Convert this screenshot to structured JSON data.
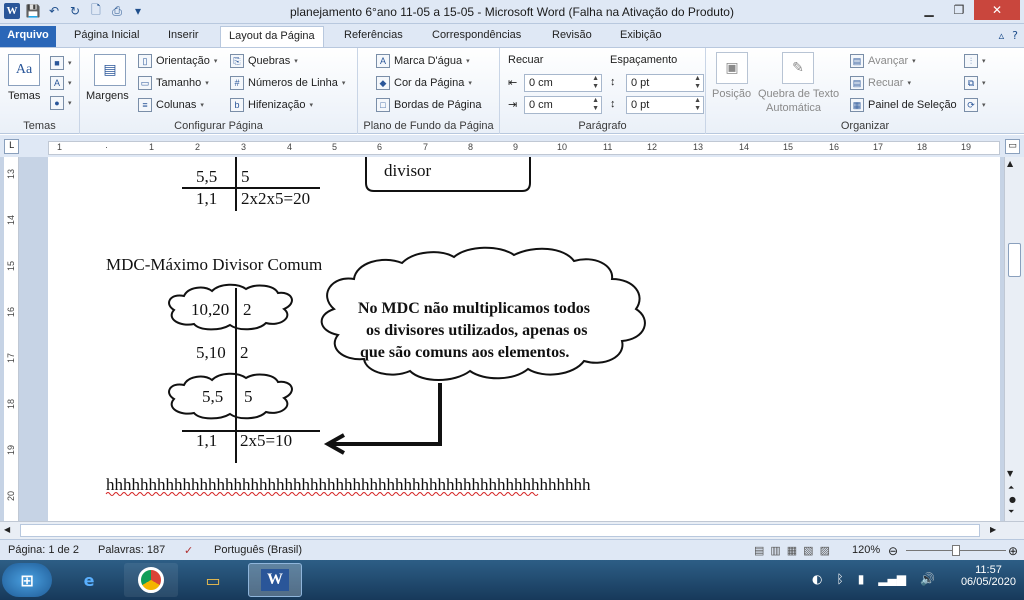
{
  "window": {
    "title": "planejamento 6°ano 11-05 a 15-05  -  Microsoft Word (Falha na Ativação do Produto)"
  },
  "qat": {
    "logo": "W",
    "save": "💾",
    "undo": "↶",
    "redo": "↻",
    "preview": "🗋",
    "print": "⎙",
    "more": "▾"
  },
  "tabs": [
    {
      "label": "Arquivo"
    },
    {
      "label": "Página Inicial"
    },
    {
      "label": "Inserir"
    },
    {
      "label": "Layout da Página"
    },
    {
      "label": "Referências"
    },
    {
      "label": "Correspondências"
    },
    {
      "label": "Revisão"
    },
    {
      "label": "Exibição"
    }
  ],
  "ribbon": {
    "temas": {
      "label": "Temas",
      "group": "Temas"
    },
    "configurar": {
      "margens": "Margens",
      "orientacao": "Orientação",
      "tamanho": "Tamanho",
      "colunas": "Colunas",
      "quebras": "Quebras",
      "numeros_linha": "Números de Linha",
      "hifenizacao": "Hifenização",
      "group": "Configurar Página"
    },
    "fundo": {
      "marca_dagua": "Marca D'água",
      "cor_pagina": "Cor da Página",
      "bordas": "Bordas de Página",
      "group": "Plano de Fundo da Página"
    },
    "paragrafo": {
      "recuar": "Recuar",
      "espacamento": "Espaçamento",
      "recuo_esq": "0 cm",
      "recuo_dir": "0 cm",
      "esp_antes": "0 pt",
      "esp_depois": "0 pt",
      "group": "Parágrafo"
    },
    "organizar": {
      "posicao": "Posição",
      "quebra_texto_1": "Quebra de Texto",
      "quebra_texto_2": "Automática",
      "avancar": "Avançar",
      "recuar": "Recuar",
      "painel": "Painel de Seleção",
      "group": "Organizar"
    }
  },
  "document": {
    "top_cloud_text": "divisor",
    "top_row1_left": "5,5",
    "top_row1_right": "5",
    "top_row2_left": "1,1",
    "top_row2_right": "2x2x5=20",
    "heading": "MDC-Máximo Divisor Comum",
    "row1_left": "10,20",
    "row1_right": "2",
    "row2_left": "5,10",
    "row2_right": "2",
    "row3_left": "5,5",
    "row3_right": "5",
    "row4_left": "1,1",
    "row4_right": "2x5=10",
    "callout_line1": "No MDC não multiplicamos todos",
    "callout_line2": "os divisores utilizados, apenas os",
    "callout_line3": "que são comuns aos elementos.",
    "typed_line": "hhhhhhhhhhhhhhhhhhhhhhhhhhhhhhhhhhhhhhhhhhhhhhhhhhhhhhhhh"
  },
  "status": {
    "page": "Página: 1 de 2",
    "words": "Palavras: 187",
    "language": "Português (Brasil)",
    "zoom": "120%"
  },
  "taskbar": {
    "time": "11:57",
    "date": "06/05/2020",
    "word_label": "W"
  },
  "colors": {
    "accent": "#2a67b8",
    "ribbon_bg": "#dfe8f5",
    "spellcheck": "#d42020"
  }
}
